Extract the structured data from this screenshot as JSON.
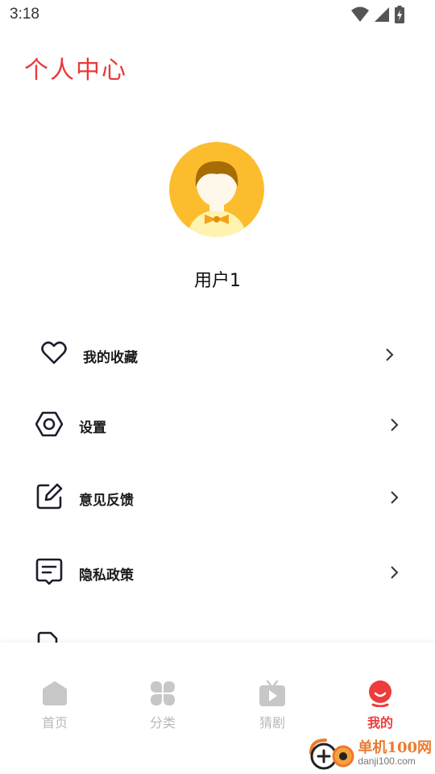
{
  "status_bar": {
    "time": "3:18"
  },
  "header": {
    "title": "个人中心"
  },
  "profile": {
    "username": "用户1"
  },
  "menu": {
    "items": [
      {
        "label": "我的收藏",
        "icon": "heart-icon"
      },
      {
        "label": "设置",
        "icon": "hexagon-settings-icon"
      },
      {
        "label": "意见反馈",
        "icon": "edit-feedback-icon"
      },
      {
        "label": "隐私政策",
        "icon": "privacy-document-icon"
      }
    ]
  },
  "tab_bar": {
    "tabs": [
      {
        "label": "首页",
        "icon": "home-icon",
        "active": false
      },
      {
        "label": "分类",
        "icon": "category-grid-icon",
        "active": false
      },
      {
        "label": "猜剧",
        "icon": "tv-play-icon",
        "active": false
      },
      {
        "label": "我的",
        "icon": "profile-face-icon",
        "active": true
      }
    ]
  },
  "watermark": {
    "name": "单机100网",
    "domain": "danji100.com"
  },
  "colors": {
    "accent": "#ee3b3b",
    "title": "#e83a3a",
    "inactive": "#c7c7c7",
    "avatar_bg": "#fbbd2e"
  }
}
